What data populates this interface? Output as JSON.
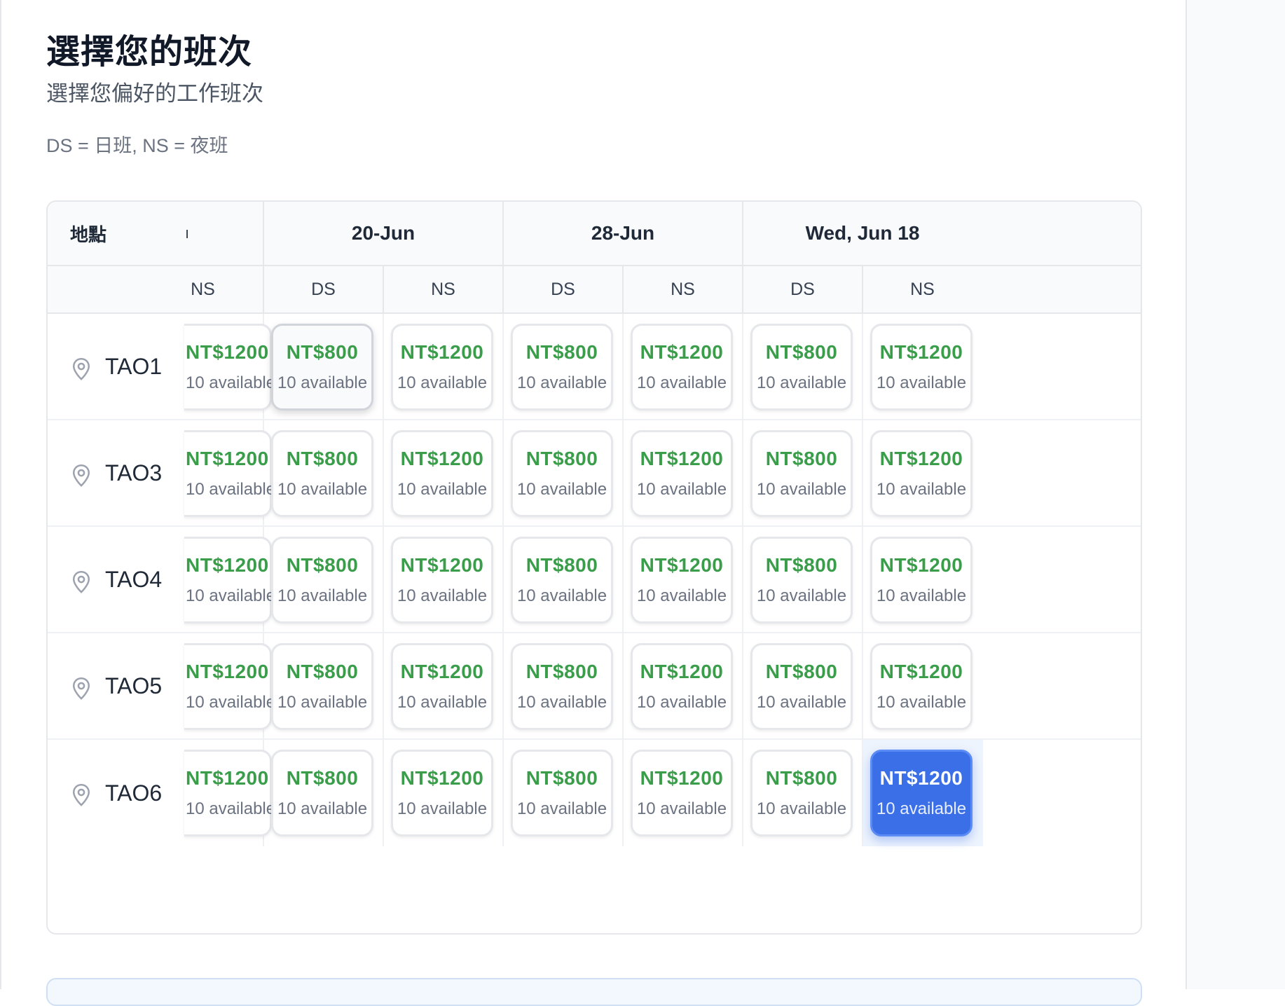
{
  "page": {
    "title": "選擇您的班次",
    "subtitle": "選擇您偏好的工作班次",
    "legend": "DS = 日班, NS = 夜班"
  },
  "table": {
    "location_header": "地點",
    "clipped_header_glyph": "ı",
    "dates": [
      "20-Jun",
      "28-Jun",
      "Wed, Jun 18"
    ],
    "shift_headers": [
      "NS",
      "DS",
      "NS",
      "DS",
      "NS",
      "DS",
      "NS"
    ],
    "rows": [
      {
        "location": "TAO1",
        "cells": [
          {
            "price": "NT$1200",
            "avail": "10 available",
            "state": "normal"
          },
          {
            "price": "NT$800",
            "avail": "10 available",
            "state": "hover"
          },
          {
            "price": "NT$1200",
            "avail": "10 available",
            "state": "normal"
          },
          {
            "price": "NT$800",
            "avail": "10 available",
            "state": "normal"
          },
          {
            "price": "NT$1200",
            "avail": "10 available",
            "state": "normal"
          },
          {
            "price": "NT$800",
            "avail": "10 available",
            "state": "normal"
          },
          {
            "price": "NT$1200",
            "avail": "10 available",
            "state": "normal"
          }
        ]
      },
      {
        "location": "TAO3",
        "cells": [
          {
            "price": "NT$1200",
            "avail": "10 available",
            "state": "normal"
          },
          {
            "price": "NT$800",
            "avail": "10 available",
            "state": "normal"
          },
          {
            "price": "NT$1200",
            "avail": "10 available",
            "state": "normal"
          },
          {
            "price": "NT$800",
            "avail": "10 available",
            "state": "normal"
          },
          {
            "price": "NT$1200",
            "avail": "10 available",
            "state": "normal"
          },
          {
            "price": "NT$800",
            "avail": "10 available",
            "state": "normal"
          },
          {
            "price": "NT$1200",
            "avail": "10 available",
            "state": "normal"
          }
        ]
      },
      {
        "location": "TAO4",
        "cells": [
          {
            "price": "NT$1200",
            "avail": "10 available",
            "state": "normal"
          },
          {
            "price": "NT$800",
            "avail": "10 available",
            "state": "normal"
          },
          {
            "price": "NT$1200",
            "avail": "10 available",
            "state": "normal"
          },
          {
            "price": "NT$800",
            "avail": "10 available",
            "state": "normal"
          },
          {
            "price": "NT$1200",
            "avail": "10 available",
            "state": "normal"
          },
          {
            "price": "NT$800",
            "avail": "10 available",
            "state": "normal"
          },
          {
            "price": "NT$1200",
            "avail": "10 available",
            "state": "normal"
          }
        ]
      },
      {
        "location": "TAO5",
        "cells": [
          {
            "price": "NT$1200",
            "avail": "10 available",
            "state": "normal"
          },
          {
            "price": "NT$800",
            "avail": "10 available",
            "state": "normal"
          },
          {
            "price": "NT$1200",
            "avail": "10 available",
            "state": "normal"
          },
          {
            "price": "NT$800",
            "avail": "10 available",
            "state": "normal"
          },
          {
            "price": "NT$1200",
            "avail": "10 available",
            "state": "normal"
          },
          {
            "price": "NT$800",
            "avail": "10 available",
            "state": "normal"
          },
          {
            "price": "NT$1200",
            "avail": "10 available",
            "state": "normal"
          }
        ]
      },
      {
        "location": "TAO6",
        "cells": [
          {
            "price": "NT$1200",
            "avail": "10 available",
            "state": "normal"
          },
          {
            "price": "NT$800",
            "avail": "10 available",
            "state": "normal"
          },
          {
            "price": "NT$1200",
            "avail": "10 available",
            "state": "normal"
          },
          {
            "price": "NT$800",
            "avail": "10 available",
            "state": "normal"
          },
          {
            "price": "NT$1200",
            "avail": "10 available",
            "state": "normal"
          },
          {
            "price": "NT$800",
            "avail": "10 available",
            "state": "normal"
          },
          {
            "price": "NT$1200",
            "avail": "10 available",
            "state": "selected"
          }
        ]
      }
    ]
  },
  "colors": {
    "price_green": "#3a9d4a",
    "selected_blue": "#3b6fe8",
    "border": "#e5e7eb"
  },
  "icons": {
    "location": "map-pin-icon"
  }
}
